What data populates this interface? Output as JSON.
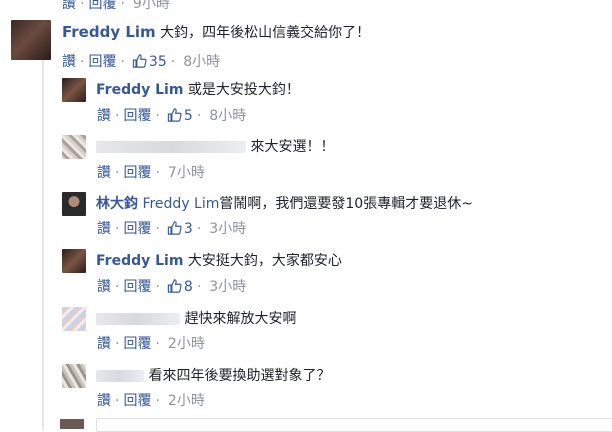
{
  "top_partial": {
    "like": "讚",
    "reply": "回覆",
    "time": "9小時"
  },
  "main_comment": {
    "author": "Freddy Lim",
    "text": "大鈞，四年後松山信義交給你了！",
    "like": "讚",
    "reply": "回覆",
    "likes": "35",
    "time": "8小時"
  },
  "replies": [
    {
      "author": "Freddy Lim",
      "text": "或是大安投大鈞！",
      "like": "讚",
      "reply": "回覆",
      "likes": "5",
      "time": "8小時"
    },
    {
      "author": "",
      "text": "來大安選！！",
      "like": "讚",
      "reply": "回覆",
      "likes": "",
      "time": "7小時"
    },
    {
      "author": "林大鈞",
      "mention": "Freddy Lim",
      "text": "嘗鬧啊，我們還要發10張專輯才要退休~",
      "like": "讚",
      "reply": "回覆",
      "likes": "3",
      "time": "3小時"
    },
    {
      "author": "Freddy Lim",
      "text": "大安挺大鈞，大家都安心",
      "like": "讚",
      "reply": "回覆",
      "likes": "8",
      "time": "3小時"
    },
    {
      "author": "",
      "text": "趕快來解放大安啊",
      "like": "讚",
      "reply": "回覆",
      "likes": "",
      "time": "2小時"
    },
    {
      "author": "",
      "text": "看來四年後要換助選對象了？",
      "like": "讚",
      "reply": "回覆",
      "likes": "",
      "time": "2小時"
    }
  ],
  "colors": {
    "link": "#365899",
    "meta": "#90949c",
    "text": "#1d2129",
    "line": "#e3e6ea"
  },
  "icons": {
    "like_count": "thumbs-up-icon"
  }
}
